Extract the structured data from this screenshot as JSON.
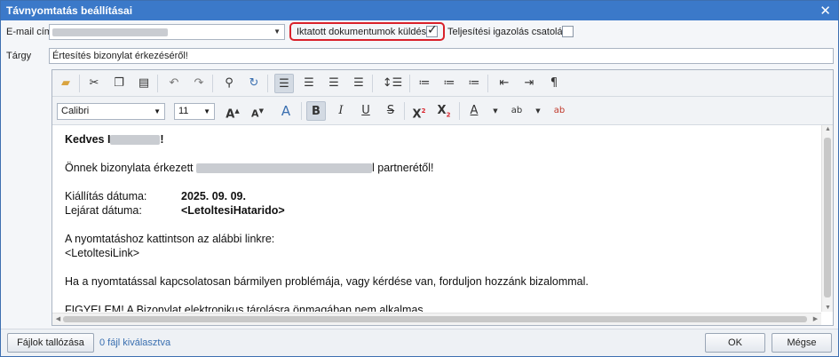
{
  "window": {
    "title": "Távnyomtatás beállításai",
    "close_glyph": "✕"
  },
  "form": {
    "email_label": "E-mail cím",
    "email_value": "",
    "send_docs_label": "Iktatott dokumentumok küldése",
    "send_docs_checked": true,
    "completion_label": "Teljesítési igazolás csatolása",
    "completion_checked": false,
    "subject_label": "Tárgy",
    "subject_value": "Értesítés bizonylat érkezéséről!"
  },
  "toolbar": {
    "font_name": "Calibri",
    "font_size": "11",
    "icons_row1": [
      "open-folder-icon",
      "cut-icon",
      "copy-icon",
      "paste-icon",
      "undo-icon",
      "redo-icon",
      "find-icon",
      "replace-icon",
      "align-left-icon",
      "align-center-icon",
      "align-right-icon",
      "justify-icon",
      "line-spacing-icon",
      "bullet-list-icon",
      "numbered-list-icon",
      "multilevel-list-icon",
      "indent-decrease-icon",
      "indent-increase-icon",
      "paragraph-mark-icon"
    ],
    "icons_row2": [
      "grow-font-icon",
      "shrink-font-icon",
      "font-color-a-icon",
      "bold-icon",
      "italic-icon",
      "underline-icon",
      "strikethrough-icon",
      "superscript-icon",
      "subscript-icon",
      "font-color-icon",
      "highlight-icon",
      "clear-format-icon"
    ]
  },
  "content": {
    "greeting_prefix": "Kedves I",
    "greeting_suffix": "!",
    "received_prefix": "Önnek bizonylata érkezett",
    "received_suffix": "l partnerétől!",
    "issue_label": "Kiállítás dátuma:",
    "issue_value": "2025. 09. 09.",
    "due_label": "Lejárat dátuma:",
    "due_value": "<LetoltesiHatarido>",
    "print_line": "A nyomtatáshoz kattintson az alábbi linkre:",
    "link_placeholder": "<LetoltesiLink>",
    "help_line": "Ha a nyomtatással kapcsolatosan bármilyen problémája, vagy kérdése van, forduljon hozzánk bizalommal.",
    "cut_line": "FIGYELEM! A Bizonylat elektronikus tárolásra önmagában nem alkalmas"
  },
  "footer": {
    "browse_label": "Fájlok tallózása",
    "files_selected": "0 fájl kiválasztva",
    "ok_label": "OK",
    "cancel_label": "Mégse"
  }
}
